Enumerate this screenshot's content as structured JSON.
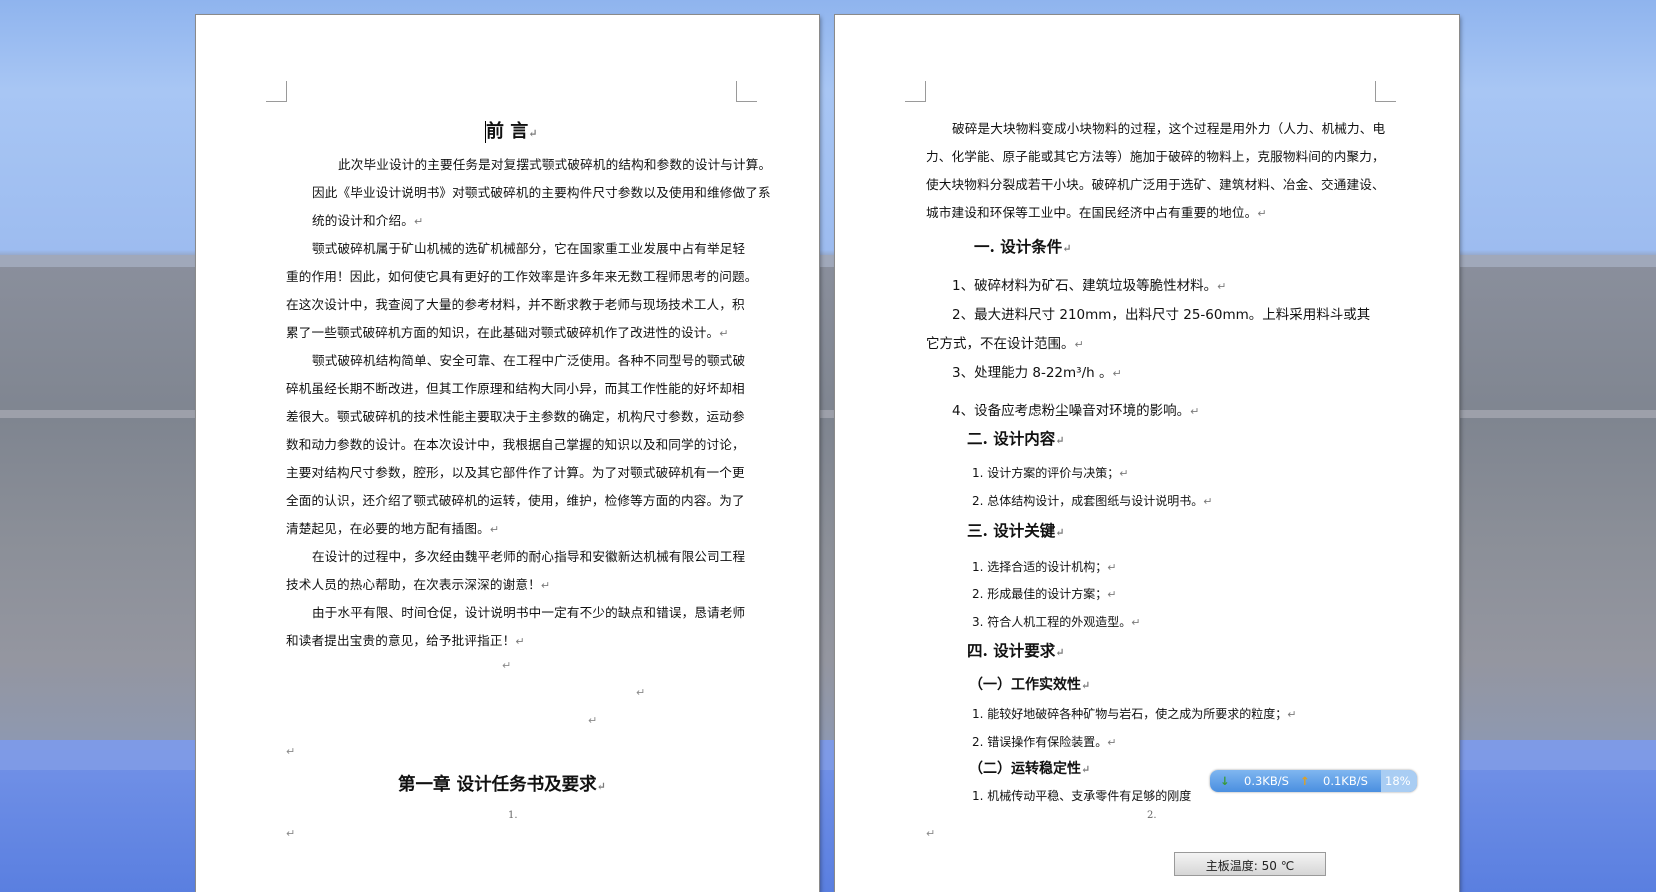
{
  "left_page": {
    "title": "前  言",
    "paragraphs": [
      [
        "此次毕业设计的主要任务是对复摆式颚式破碎机的结构和参数的设计与计算。",
        "因此《毕业设计说明书》对颚式破碎机的主要构件尺寸参数以及使用和维修做了系",
        "统的设计和介绍。"
      ],
      [
        "颚式破碎机属于矿山机械的选矿机械部分，它在国家重工业发展中占有举足轻",
        "重的作用！因此，如何使它具有更好的工作效率是许多年来无数工程师思考的问题。",
        "在这次设计中，我查阅了大量的参考材料，并不断求教于老师与现场技术工人，积",
        "累了一些颚式破碎机方面的知识，在此基础对颚式破碎机作了改进性的设计。"
      ],
      [
        "颚式破碎机结构简单、安全可靠、在工程中广泛使用。各种不同型号的颚式破",
        "碎机虽经长期不断改进，但其工作原理和结构大同小异，而其工作性能的好坏却相",
        "差很大。颚式破碎机的技术性能主要取决于主参数的确定，机构尺寸参数，运动参",
        "数和动力参数的设计。在本次设计中，我根据自己掌握的知识以及和同学的讨论，",
        "主要对结构尺寸参数，腔形，以及其它部件作了计算。为了对颚式破碎机有一个更",
        "全面的认识，还介绍了颚式破碎机的运转，使用，维护，检修等方面的内容。为了",
        "清楚起见，在必要的地方配有插图。"
      ],
      [
        "在设计的过程中，多次经由魏平老师的耐心指导和安徽新达机械有限公司工程",
        "技术人员的热心帮助，在次表示深深的谢意！"
      ],
      [
        "由于水平有限、时间仓促，设计说明书中一定有不少的缺点和错误，恳请老师",
        "和读者提出宝贵的意见，给予批评指正！"
      ]
    ],
    "chapter_heading": "第一章    设计任务书及要求",
    "page_number": "1."
  },
  "right_page": {
    "intro": [
      "破碎是大块物料变成小块物料的过程，这个过程是用外力（人力、机械力、电",
      "力、化学能、原子能或其它方法等）施加于破碎的物料上，克服物料间的内聚力，",
      "使大块物料分裂成若干小块。破碎机广泛用于选矿、建筑材料、冶金、交通建设、",
      "城市建设和环保等工业中。在国民经济中占有重要的地位。"
    ],
    "section1_title": "一. 设计条件",
    "conditions": [
      "1、破碎材料为矿石、建筑垃圾等脆性材料。",
      "2、最大进料尺寸 210mm，出料尺寸 25-60mm。上料采用料斗或其",
      "它方式，不在设计范围。",
      "3、处理能力 8-22m³/h 。",
      "4、设备应考虑粉尘噪音对环境的影响。"
    ],
    "section2_title": "二. 设计内容",
    "contents": [
      "1. 设计方案的评价与决策；",
      "2. 总体结构设计，成套图纸与设计说明书。"
    ],
    "section3_title": "三. 设计关键",
    "keys": [
      "1. 选择合适的设计机构；",
      "2. 形成最佳的设计方案；",
      "3. 符合人机工程的外观造型。"
    ],
    "section4_title": "四. 设计要求",
    "sub1_title": "（一）工作实效性",
    "sub1_items": [
      "1. 能较好地破碎各种矿物与岩石，使之成为所要求的粒度；",
      "2. 错误操作有保险装置。"
    ],
    "sub2_title": "（二）运转稳定性",
    "sub2_items": [
      "1. 机械传动平稳、支承零件有足够的刚度"
    ],
    "page_number": "2."
  },
  "widgets": {
    "download_speed": "0.3KB/S",
    "upload_speed": "0.1KB/S",
    "cpu_percent": "18%",
    "mainboard_temp": "主板温度: 50 ℃"
  },
  "para_mark": "↵"
}
